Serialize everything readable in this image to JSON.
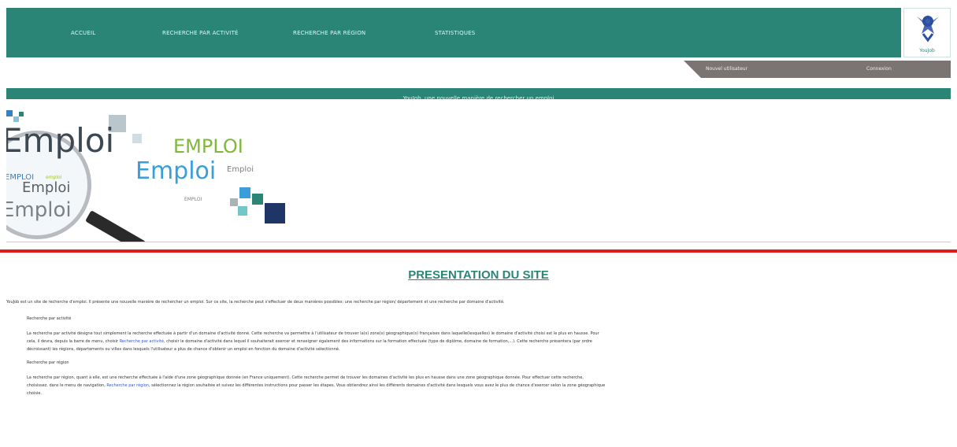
{
  "nav": {
    "items": [
      {
        "label": "Accueil"
      },
      {
        "label": "Recherche par activité"
      },
      {
        "label": "Recherche par région"
      },
      {
        "label": "Statistiques"
      }
    ]
  },
  "logo": {
    "text": "YouJob"
  },
  "user_bar": {
    "new_user": "Nouvel utilisateur",
    "login": "Connexion"
  },
  "slogan": "YouJob, une nouvelle manière de rechercher un emploi",
  "banner": {
    "words": {
      "big": "Emploi",
      "caps": "EMPLOI",
      "mid": "Emploi",
      "small": "Emploi",
      "tiny_caps_1": "EMPLOI",
      "tiny_caps_2": "EMPLOI",
      "lens_small": "emploi",
      "lens_mid": "Emploi"
    }
  },
  "content": {
    "title": "PRESENTATION DU SITE",
    "intro": "YouJob est un site de recherche d'emploi. Il présente une nouvelle manière de rechercher un emploi. Sur ce site, la recherche peut s'effectuer de deux manières possibles: une recherche par région/ département et une recherche par domaine d'activité.",
    "section1": {
      "heading": "Recherche par activité",
      "text_a": "La recherche par activité désigne tout simplement la recherche effectuée à partir d'un domaine d'activité donné. Cette recherche va permettre à l'utilisateur de trouver la(s) zone(s) géographique(s) françaises dans laquelle(lesquelles) le domaine d'activité choisi est le plus en hausse. Pour",
      "text_b_pre": "cela, il devra, depuis la barre de menu, choisir ",
      "link": "Recherche par activité",
      "text_b_post": ", choisir le domaine d'activité dans lequel il souhaiterait exercer et renseigner également des informations sur la formation effectuée (type de diplôme, domaine de formation,...). Cette recherche présentera (par ordre",
      "text_c": "décroissant) les régions, départements ou villes dans lesquels l'utilisateur a plus de chance d'obtenir un emploi en fonction du domaine d'activité sélectionné."
    },
    "section2": {
      "heading": "Recherche par région",
      "text_a": "La recherche par région, quant à elle, est une recherche effectuée à l'aide d'une zone géographique donnée (en France uniquement). Cette recherche permet de trouver les domaines d'activité les plus en hausse dans une zone géographique donnée. Pour effectuer cette recherche,",
      "text_b_pre": "choisissez, dans le menu de navigation, ",
      "link": "Recherche par région",
      "text_b_post": ", sélectionnez la région souhaitée et suivez les différentes instructions pour passer les étapes. Vous obtiendrez ainsi les différents domaines d'activité dans lesquels vous avez le plus de chance d'exercer selon la zone géographique",
      "text_c": "choisie."
    }
  },
  "colors": {
    "accent": "#2b8577",
    "separator": "#e21b1b",
    "user_bar": "#7a7472",
    "link": "#3355cc"
  }
}
